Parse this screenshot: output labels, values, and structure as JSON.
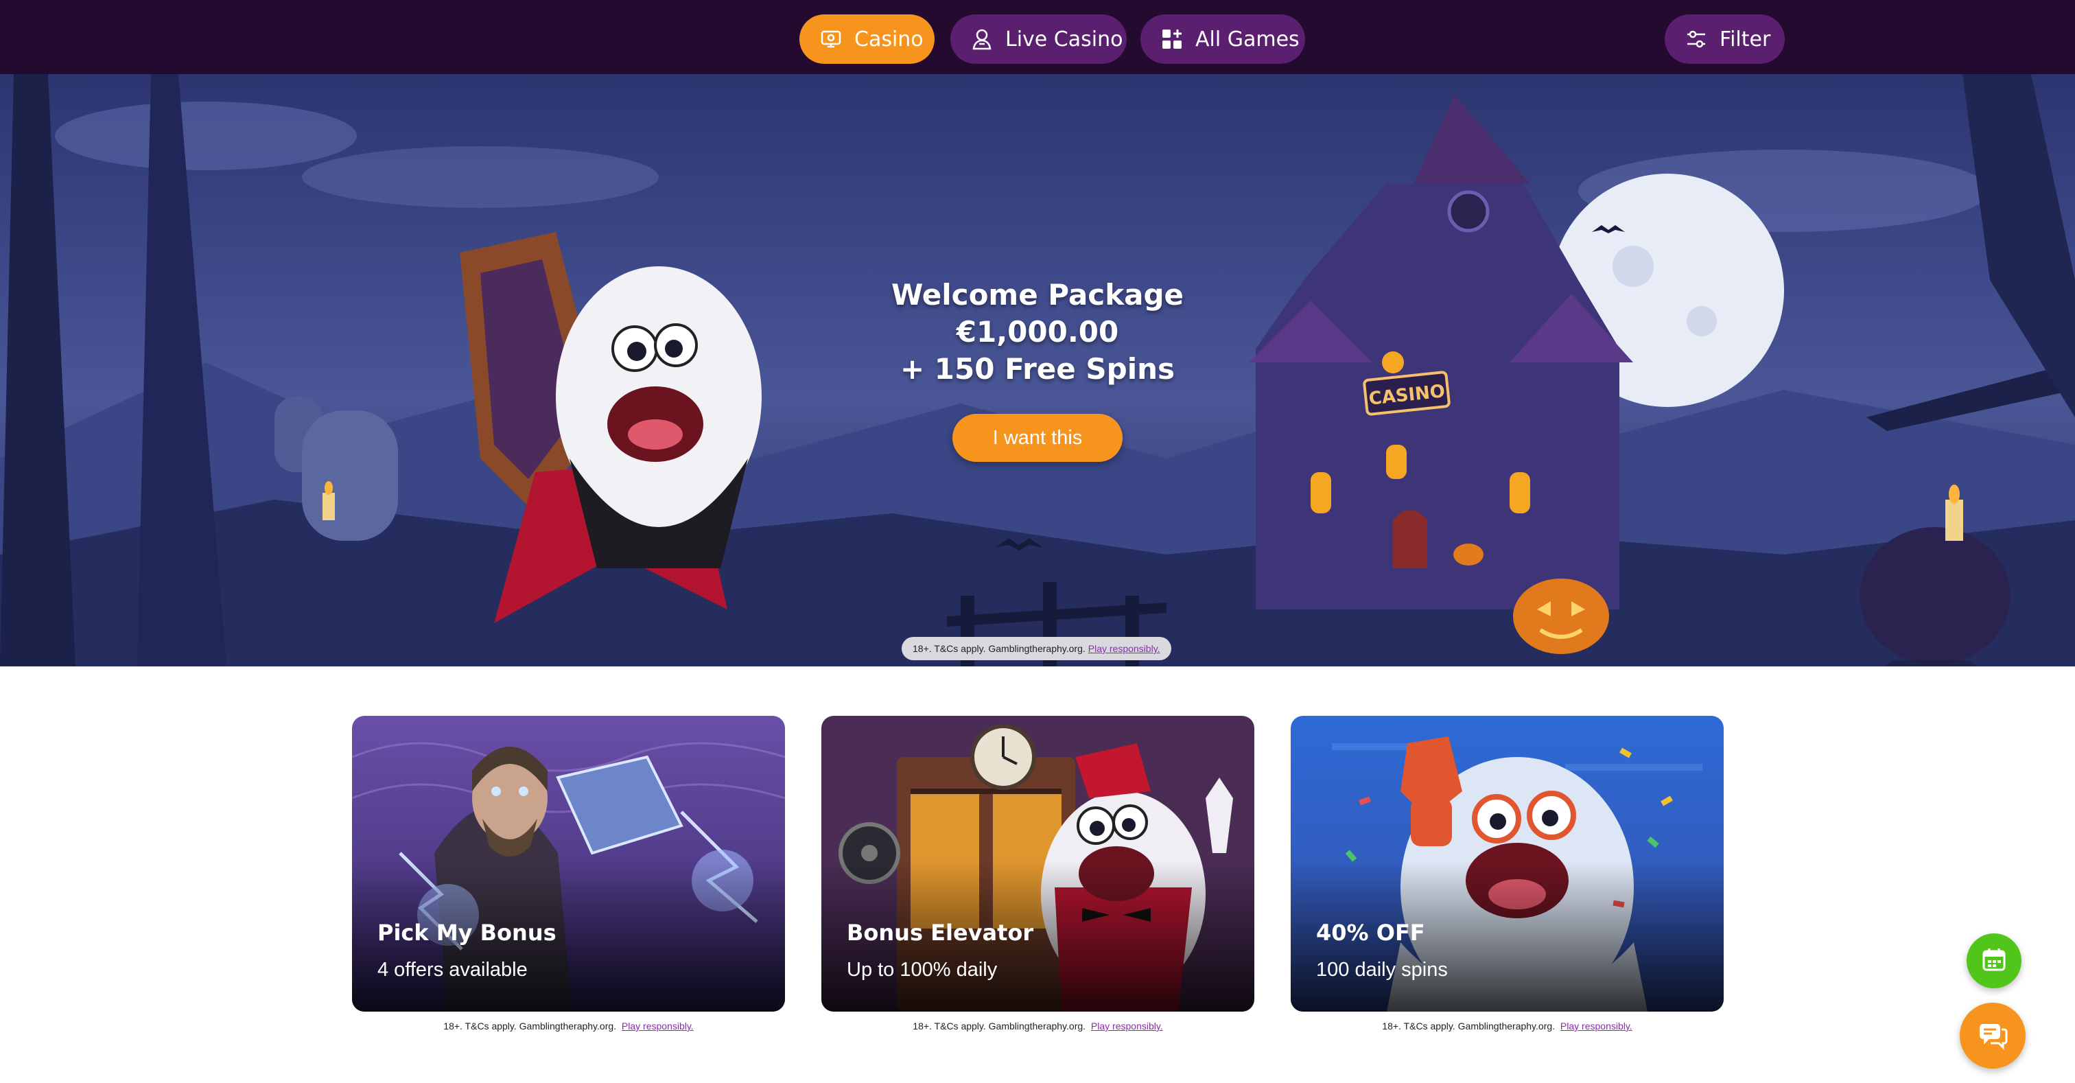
{
  "nav": {
    "tabs": [
      {
        "label": "Casino",
        "icon": "casino-icon",
        "active": true
      },
      {
        "label": "Live Casino",
        "icon": "live-dealer-icon",
        "active": false
      },
      {
        "label": "All Games",
        "icon": "grid-icon",
        "active": false
      }
    ],
    "filter_label": "Filter",
    "filter_icon": "sliders-icon"
  },
  "hero": {
    "line1": "Welcome Package",
    "line2": "€1,000.00",
    "line3": "+ 150 Free Spins",
    "cta": "I want this",
    "sign": "CASINO",
    "slides": 4,
    "active_slide": 1,
    "disclaimer": "18+. T&Cs apply. Gamblingtheraphy.org.",
    "disclaimer_link": "Play responsibly."
  },
  "cards": [
    {
      "title": "Pick My Bonus",
      "subtitle": "4 offers available",
      "disclaimer": "18+. T&Cs apply. Gamblingtheraphy.org.",
      "link": "Play responsibly."
    },
    {
      "title": "Bonus Elevator",
      "subtitle": "Up to 100% daily",
      "disclaimer": "18+. T&Cs apply. Gamblingtheraphy.org.",
      "link": "Play responsibly."
    },
    {
      "title": "40% OFF",
      "subtitle": "100 daily spins",
      "disclaimer": "18+. T&Cs apply. Gamblingtheraphy.org.",
      "link": "Play responsibly."
    }
  ],
  "floating": {
    "calendar_icon": "calendar-icon",
    "chat_icon": "chat-icon"
  },
  "colors": {
    "topbar": "#230a2e",
    "accent": "#f7941d",
    "pill": "#5a1f6e",
    "calendar_button": "#52c51a"
  }
}
